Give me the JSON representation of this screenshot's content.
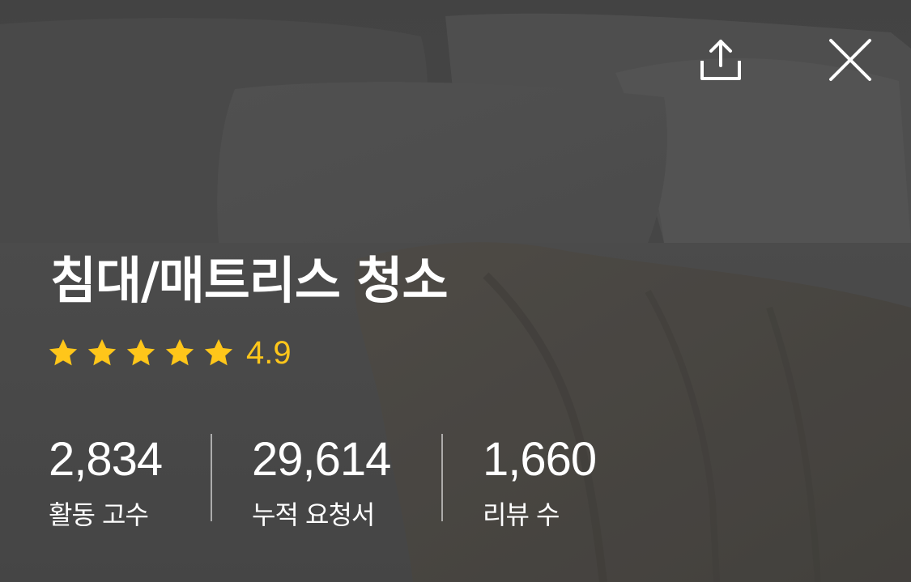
{
  "header": {
    "share_icon": "share-icon",
    "close_icon": "close-icon"
  },
  "category": {
    "title": "침대/매트리스 청소"
  },
  "rating": {
    "stars": 5,
    "max_stars": 5,
    "value": "4.9",
    "star_color": "#ffc61a"
  },
  "stats": [
    {
      "value": "2,834",
      "label": "활동 고수"
    },
    {
      "value": "29,614",
      "label": "누적 요청서"
    },
    {
      "value": "1,660",
      "label": "리뷰 수"
    }
  ],
  "colors": {
    "text": "#ffffff",
    "accent": "#ffc61a"
  }
}
